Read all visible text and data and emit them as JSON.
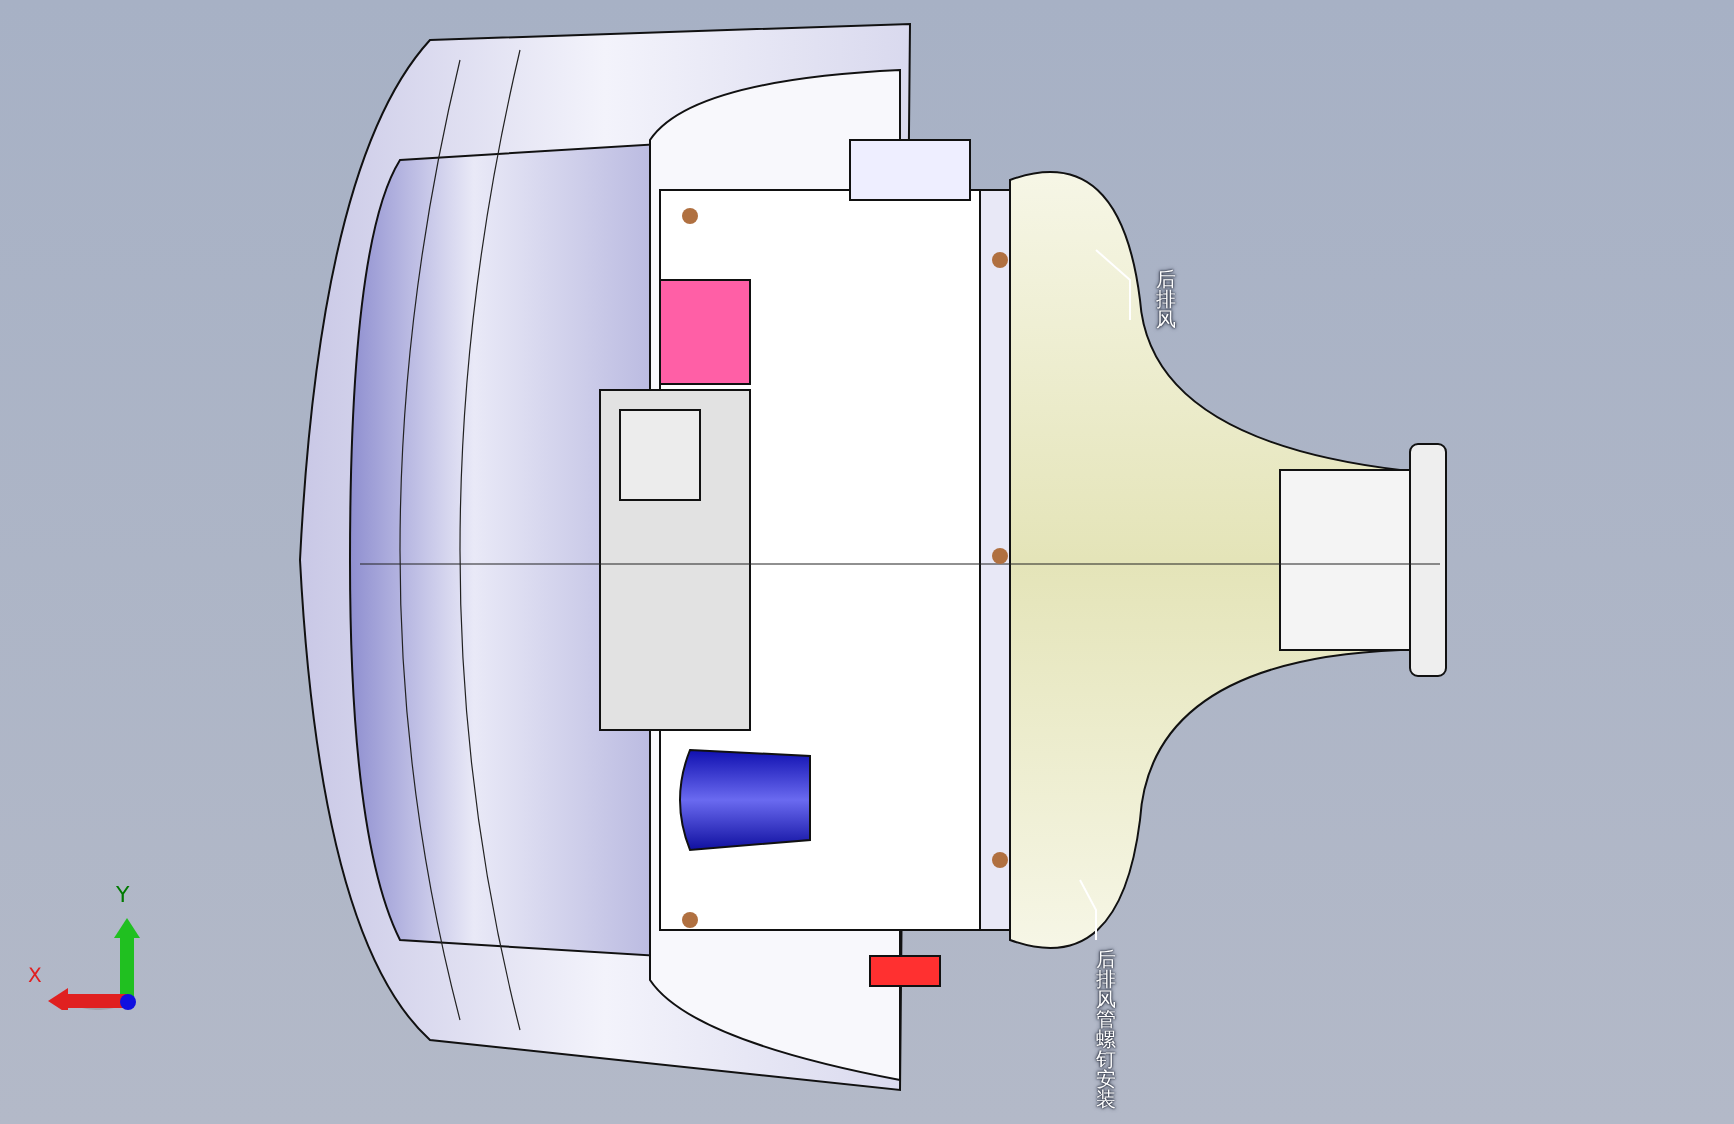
{
  "viewport": {
    "labels": [
      {
        "text": "后排风"
      },
      {
        "text": "后排风管螺钉安装"
      }
    ],
    "triad": {
      "x_label": "X",
      "y_label": "Y"
    }
  }
}
